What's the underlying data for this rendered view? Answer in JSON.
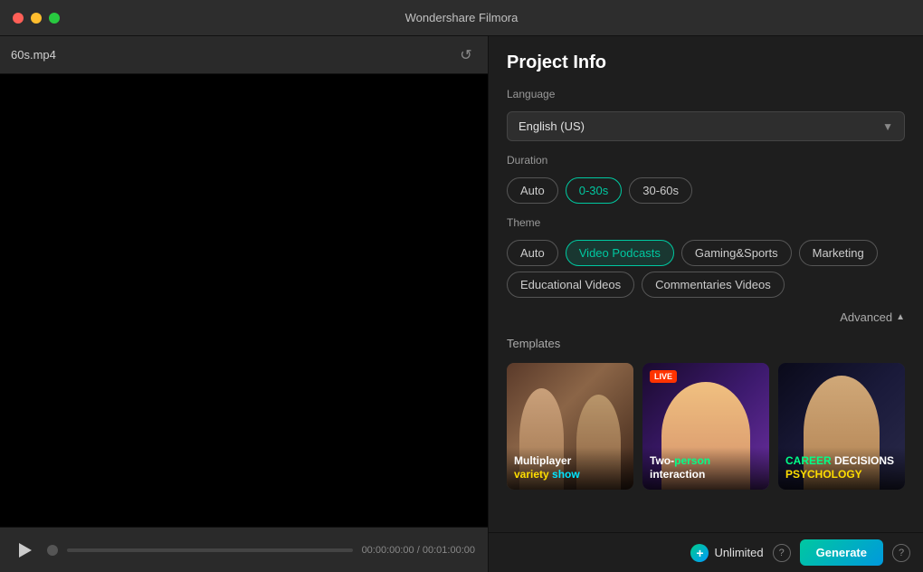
{
  "app": {
    "title": "Wondershare Filmora"
  },
  "titlebar": {
    "close": "close",
    "minimize": "minimize",
    "maximize": "maximize"
  },
  "left": {
    "filename": "60s.mp4",
    "refresh_label": "↺",
    "play_label": "play",
    "time_current": "00:00:00:00",
    "time_separator": "/",
    "time_total": "00:01:00:00"
  },
  "right": {
    "title": "Project Info",
    "language_label": "Language",
    "language_value": "English (US)",
    "duration_label": "Duration",
    "duration_options": [
      "Auto",
      "0-30s",
      "30-60s"
    ],
    "duration_active": "0-30s",
    "theme_label": "Theme",
    "theme_options": [
      "Auto",
      "Video Podcasts",
      "Gaming&Sports",
      "Marketing",
      "Educational Videos",
      "Commentaries Videos"
    ],
    "theme_active": "Video Podcasts",
    "advanced_label": "Advanced",
    "advanced_arrow": "▲",
    "templates_label": "Templates",
    "templates": [
      {
        "id": 1,
        "title_parts": [
          {
            "text": "Multiplayer",
            "color": "white"
          },
          {
            "text": " "
          },
          {
            "text": "variety",
            "color": "yellow"
          },
          {
            "text": " "
          },
          {
            "text": "show",
            "color": "cyan"
          }
        ]
      },
      {
        "id": 2,
        "badge": "LIVE",
        "title_parts": [
          {
            "text": "Two-",
            "color": "white"
          },
          {
            "text": "person",
            "color": "green"
          },
          {
            "text": " "
          },
          {
            "text": "interaction",
            "color": "white"
          }
        ]
      },
      {
        "id": 3,
        "title_parts": [
          {
            "text": "CAREER",
            "color": "green"
          },
          {
            "text": " "
          },
          {
            "text": "DECISIONS",
            "color": "white"
          },
          {
            "text": " "
          },
          {
            "text": "PSYCHOLOGY",
            "color": "yellow"
          }
        ]
      }
    ],
    "unlimited_label": "Unlimited",
    "generate_label": "Generate",
    "help_label": "?"
  }
}
